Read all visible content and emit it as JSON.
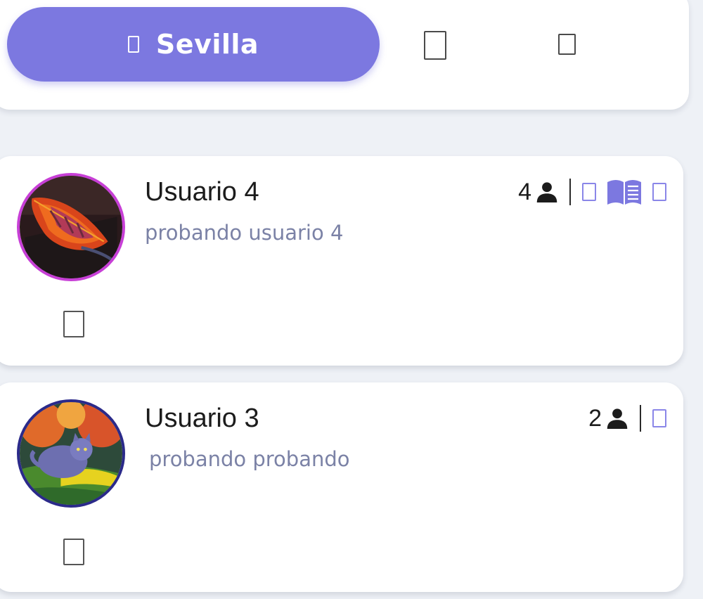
{
  "topbar": {
    "city_button_label": "Sevilla",
    "city_button_icon": "location-icon",
    "icons": [
      "grid-icon",
      "list-icon"
    ]
  },
  "colors": {
    "accent": "#7c78e0",
    "text_primary": "#1c1c1c",
    "text_secondary": "#7b82a6",
    "background": "#eef1f6"
  },
  "users": [
    {
      "name": "Usuario 4",
      "description": "probando usuario 4",
      "followers": "4",
      "icons": [
        "person-icon",
        "edit-icon",
        "book-icon",
        "share-icon",
        "comment-icon"
      ]
    },
    {
      "name": "Usuario 3",
      "description": "probando probando",
      "followers": "2",
      "icons": [
        "person-icon",
        "edit-icon",
        "comment-icon"
      ]
    }
  ]
}
